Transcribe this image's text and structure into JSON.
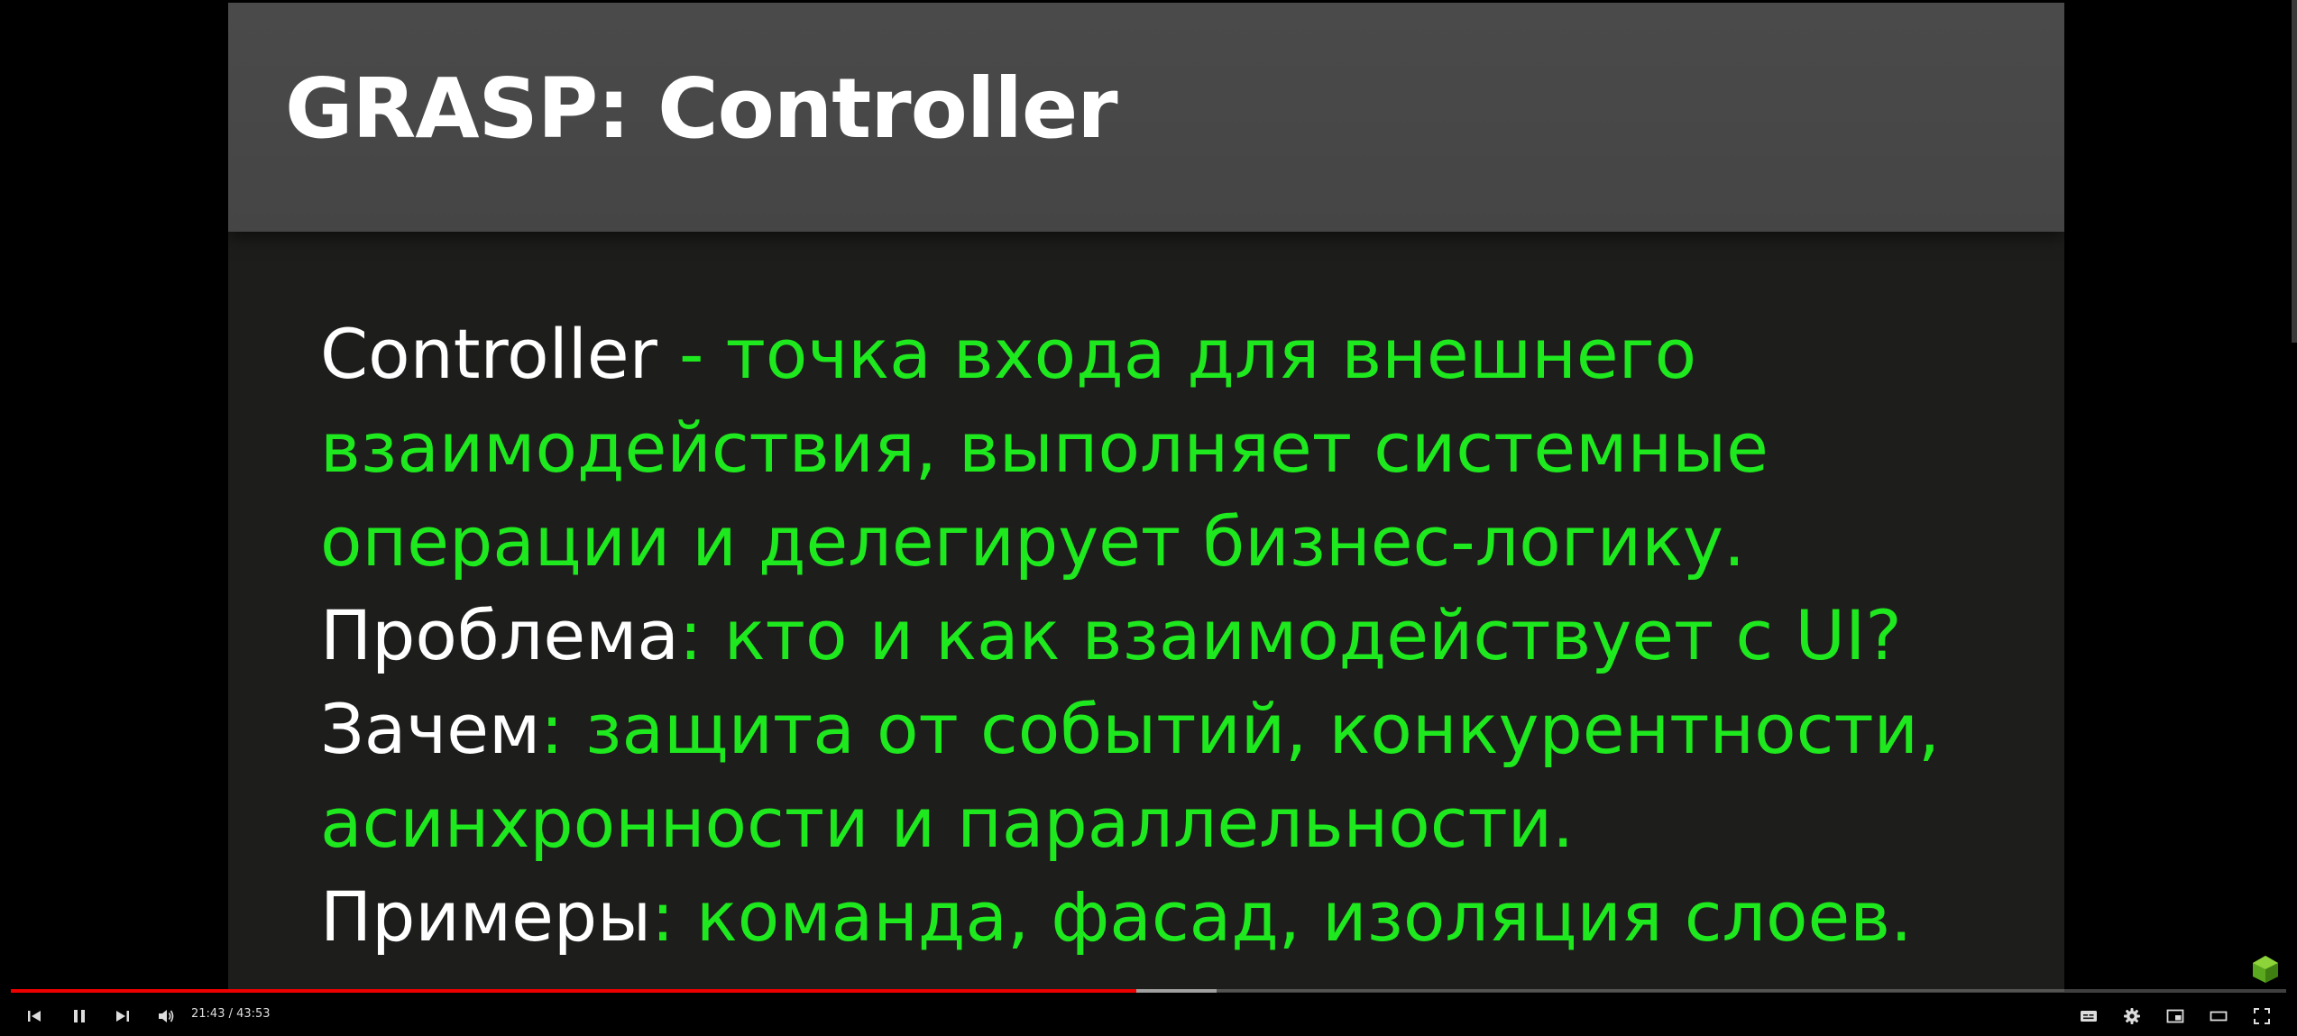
{
  "slide": {
    "title": "GRASP: Controller",
    "lines": [
      {
        "term": "Controller",
        "desc": " - точка входа для внешнего"
      },
      {
        "term": "",
        "desc": "взаимодействия, выполняет системные"
      },
      {
        "term": "",
        "desc": "операции и делегирует бизнес-логику."
      },
      {
        "term": "Проблема",
        "desc": ": кто и как взаимодействует с UI?"
      },
      {
        "term": "Зачем",
        "desc": ": защита от событий, конкурентности,"
      },
      {
        "term": "",
        "desc": "асинхронности и параллельности."
      },
      {
        "term": "Примеры",
        "desc": ": команда, фасад, изоляция слоев."
      }
    ]
  },
  "player": {
    "time_display": "21:43 / 43:53",
    "progress_fraction": 0.4947,
    "buffer_fraction": 0.53,
    "controls": {
      "left": [
        "previous-icon",
        "pause-icon",
        "next-icon",
        "volume-icon"
      ],
      "right": [
        "subtitles-icon",
        "settings-gear-icon",
        "miniplayer-icon",
        "theater-mode-icon",
        "fullscreen-icon"
      ]
    }
  },
  "colors": {
    "slide_background": "#1d1d1b",
    "header_background": "#474747",
    "term_text": "#ffffff",
    "description_text": "#1ee81e",
    "progress_played": "#ee0000"
  }
}
